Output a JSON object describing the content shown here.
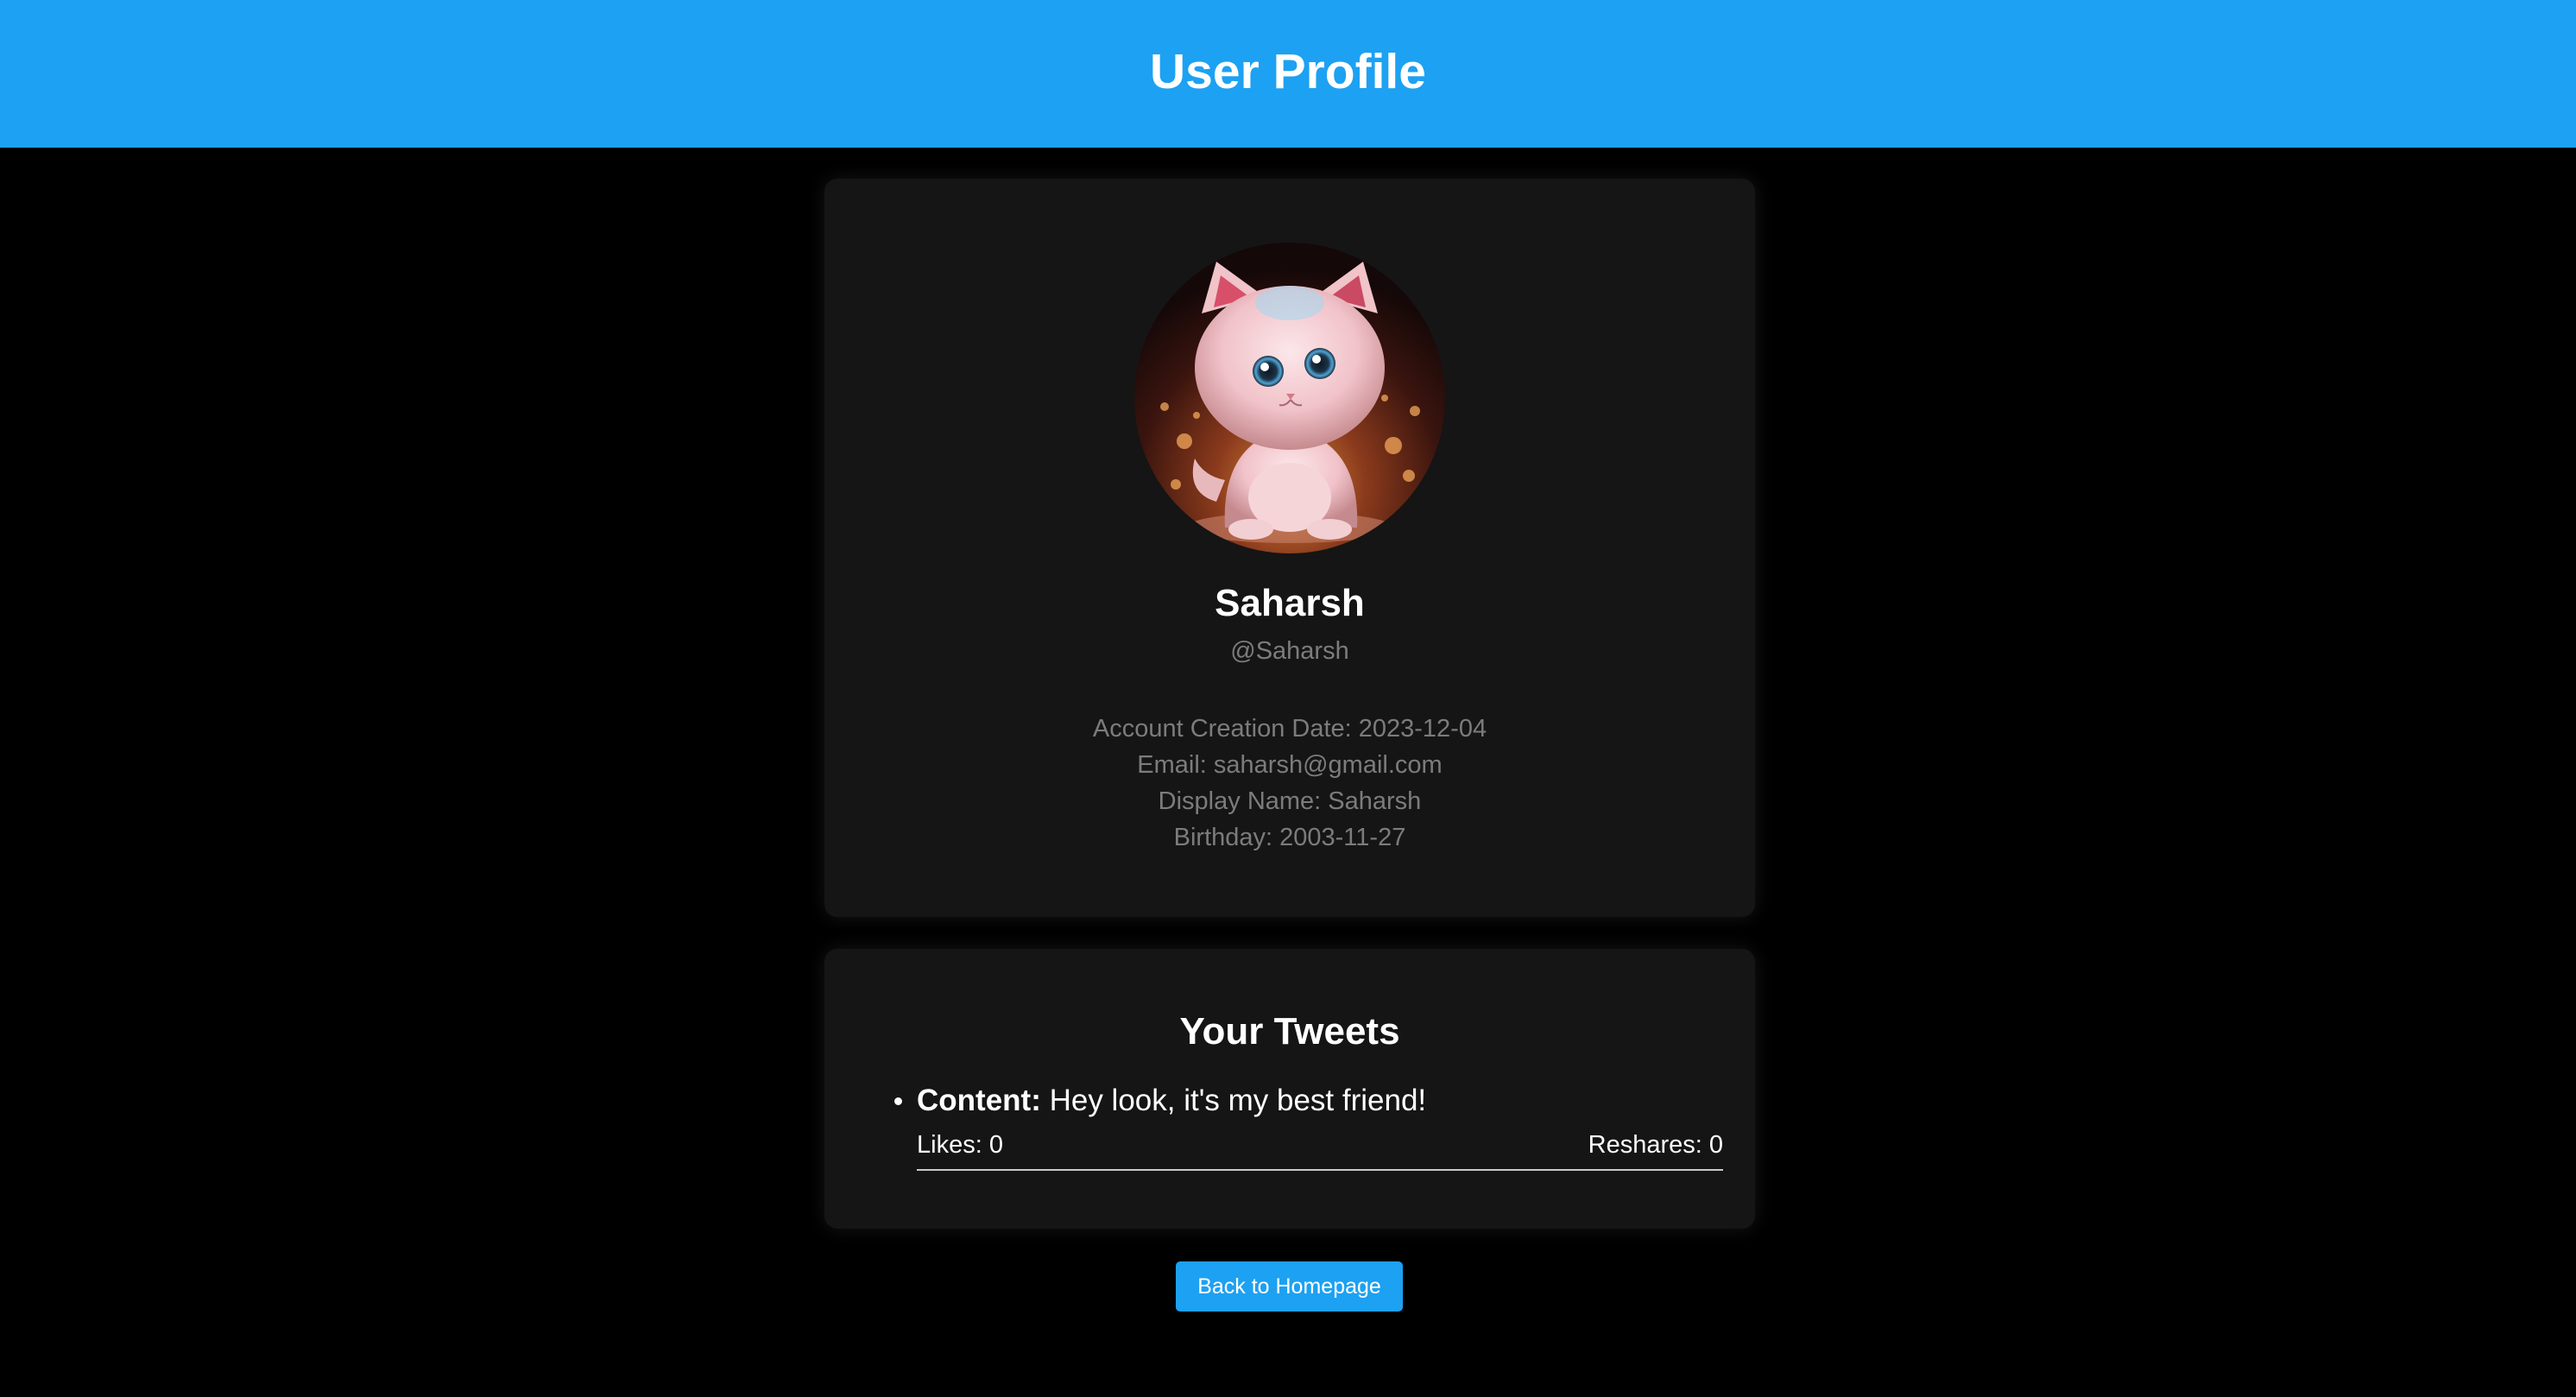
{
  "header": {
    "title": "User Profile"
  },
  "profile": {
    "avatar_icon": "kitten-avatar",
    "name": "Saharsh",
    "handle": "@Saharsh",
    "account_creation": "Account Creation Date: 2023-12-04",
    "email": "Email: saharsh@gmail.com",
    "display_name": "Display Name: Saharsh",
    "birthday": "Birthday: 2003-11-27"
  },
  "tweets": {
    "title": "Your Tweets",
    "items": [
      {
        "content_label": "Content:",
        "content": "Hey look, it's my best friend!",
        "likes": "Likes: 0",
        "reshares": "Reshares: 0"
      }
    ]
  },
  "actions": {
    "back_label": "Back to Homepage"
  },
  "colors": {
    "accent": "#1da1f2",
    "background": "#000000",
    "card": "#151515",
    "muted_text": "#7c7c7c"
  }
}
